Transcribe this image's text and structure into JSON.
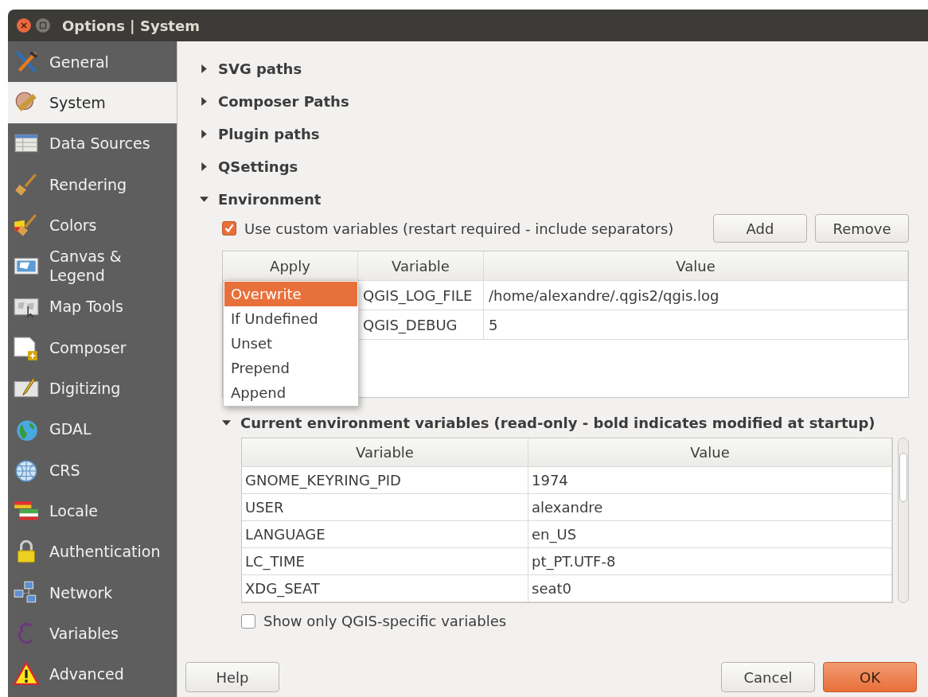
{
  "window": {
    "title": "Options | System"
  },
  "sidebar": {
    "items": [
      {
        "label": "General",
        "selected": false
      },
      {
        "label": "System",
        "selected": true
      },
      {
        "label": "Data Sources",
        "selected": false
      },
      {
        "label": "Rendering",
        "selected": false
      },
      {
        "label": "Colors",
        "selected": false
      },
      {
        "label": "Canvas &\nLegend",
        "selected": false
      },
      {
        "label": "Map Tools",
        "selected": false
      },
      {
        "label": "Composer",
        "selected": false
      },
      {
        "label": "Digitizing",
        "selected": false
      },
      {
        "label": "GDAL",
        "selected": false
      },
      {
        "label": "CRS",
        "selected": false
      },
      {
        "label": "Locale",
        "selected": false
      },
      {
        "label": "Authentication",
        "selected": false
      },
      {
        "label": "Network",
        "selected": false
      },
      {
        "label": "Variables",
        "selected": false
      },
      {
        "label": "Advanced",
        "selected": false
      }
    ]
  },
  "sections": [
    {
      "label": "SVG paths",
      "expanded": false
    },
    {
      "label": "Composer Paths",
      "expanded": false
    },
    {
      "label": "Plugin paths",
      "expanded": false
    },
    {
      "label": "QSettings",
      "expanded": false
    },
    {
      "label": "Environment",
      "expanded": true
    }
  ],
  "environment": {
    "custom_checkbox": {
      "label": "Use custom variables (restart required - include separators)",
      "checked": true
    },
    "buttons": [
      "Add",
      "Remove"
    ],
    "custom_table": {
      "columns": [
        "Apply",
        "Variable",
        "Value"
      ],
      "rows": [
        {
          "variable": "QGIS_LOG_FILE",
          "value": "/home/alexandre/.qgis2/qgis.log"
        },
        {
          "variable": "QGIS_DEBUG",
          "value": "5"
        }
      ]
    },
    "apply_dropdown": {
      "options": [
        {
          "label": "Overwrite",
          "selected": true
        },
        {
          "label": "If Undefined",
          "selected": false
        },
        {
          "label": "Unset",
          "selected": false
        },
        {
          "label": "Prepend",
          "selected": false
        },
        {
          "label": "Append",
          "selected": false
        }
      ]
    },
    "current": {
      "label": "Current environment variables (read-only - bold indicates modified at startup)",
      "expanded": true,
      "table": {
        "columns": [
          "Variable",
          "Value"
        ],
        "rows": [
          {
            "variable": "GNOME_KEYRING_PID",
            "value": "1974"
          },
          {
            "variable": "USER",
            "value": "alexandre"
          },
          {
            "variable": "LANGUAGE",
            "value": "en_US"
          },
          {
            "variable": "LC_TIME",
            "value": "pt_PT.UTF-8"
          },
          {
            "variable": "XDG_SEAT",
            "value": "seat0"
          }
        ]
      },
      "show_only_checkbox": {
        "label": "Show only QGIS-specific variables",
        "checked": false
      }
    }
  },
  "footer": {
    "buttons": [
      {
        "label": "Help",
        "kind": "default"
      },
      {
        "label": "Cancel",
        "kind": "default"
      },
      {
        "label": "OK",
        "kind": "primary"
      }
    ]
  }
}
